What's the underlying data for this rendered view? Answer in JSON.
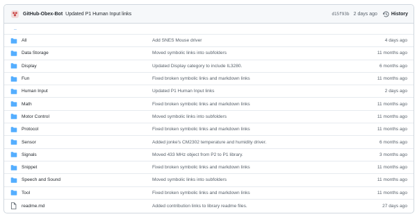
{
  "header": {
    "author": "GitHub-Obex-Bot",
    "message": "Updated P1 Human Input links",
    "sha": "d15f93b",
    "age": "2 days ago",
    "history_label": "History"
  },
  "parent_link": "..",
  "rows": [
    {
      "name": "All",
      "type": "folder",
      "message": "Add SNES Mouse driver",
      "age": "4 days ago"
    },
    {
      "name": "Data Storage",
      "type": "folder",
      "message": "Moved symbolic links into subfolders",
      "age": "11 months ago"
    },
    {
      "name": "Display",
      "type": "folder",
      "message": "Updated Display category to include IL3280.",
      "age": "6 months ago"
    },
    {
      "name": "Fun",
      "type": "folder",
      "message": "Fixed broken symbolic links and markdown links",
      "age": "11 months ago"
    },
    {
      "name": "Human Input",
      "type": "folder",
      "message": "Updated P1 Human Input links",
      "age": "2 days ago"
    },
    {
      "name": "Math",
      "type": "folder",
      "message": "Fixed broken symbolic links and markdown links",
      "age": "11 months ago"
    },
    {
      "name": "Motor Control",
      "type": "folder",
      "message": "Moved symbolic links into subfolders",
      "age": "11 months ago"
    },
    {
      "name": "Protocol",
      "type": "folder",
      "message": "Fixed broken symbolic links and markdown links",
      "age": "11 months ago"
    },
    {
      "name": "Sensor",
      "type": "folder",
      "message": "Added jonke's CM2302 temperature and humidity driver.",
      "age": "6 months ago"
    },
    {
      "name": "Signals",
      "type": "folder",
      "message": "Moved 433 MHz object from P2 to P1 library.",
      "age": "3 months ago"
    },
    {
      "name": "Snippet",
      "type": "folder",
      "message": "Fixed broken symbolic links and markdown links",
      "age": "11 months ago"
    },
    {
      "name": "Speech and Sound",
      "type": "folder",
      "message": "Moved symbolic links into subfolders",
      "age": "11 months ago"
    },
    {
      "name": "Tool",
      "type": "folder",
      "message": "Fixed broken symbolic links and markdown links",
      "age": "11 months ago"
    },
    {
      "name": "readme.md",
      "type": "file",
      "message": "Added contribution links to library readme files.",
      "age": "27 days ago"
    }
  ],
  "colors": {
    "folder": "#54aeff",
    "file": "#57606a",
    "link": "#0969da",
    "avatar": "#c94a4a"
  }
}
